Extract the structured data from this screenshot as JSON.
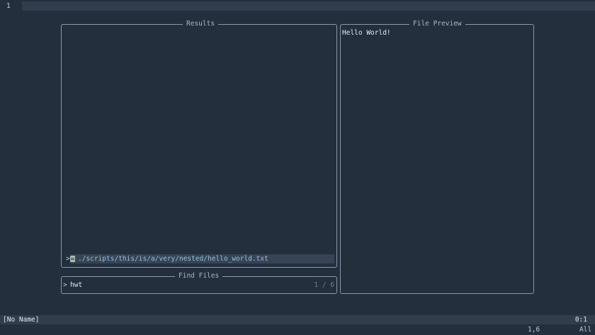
{
  "editor": {
    "line_number": "1"
  },
  "results": {
    "title": "Results",
    "selection_caret": ">",
    "selected_entry": {
      "icon": "text-file-icon",
      "path": "./scripts/this/is/a/very/nested/hello_world.txt"
    }
  },
  "preview": {
    "title": "File Preview",
    "content": "Hello World!"
  },
  "prompt": {
    "title": "Find Files",
    "caret": ">",
    "query": "hwt",
    "match_count": "1 / 6"
  },
  "statusline": {
    "buffer_name": "[No Name]",
    "position": "0:1"
  },
  "cmdline": {
    "cursor_pos": "1,6",
    "scroll": "All"
  },
  "colors": {
    "background": "#242f3d",
    "border": "#8a98ab",
    "selection_bg": "#364455",
    "path_text": "#8cc6e0",
    "file_icon": "#a6c98a"
  }
}
